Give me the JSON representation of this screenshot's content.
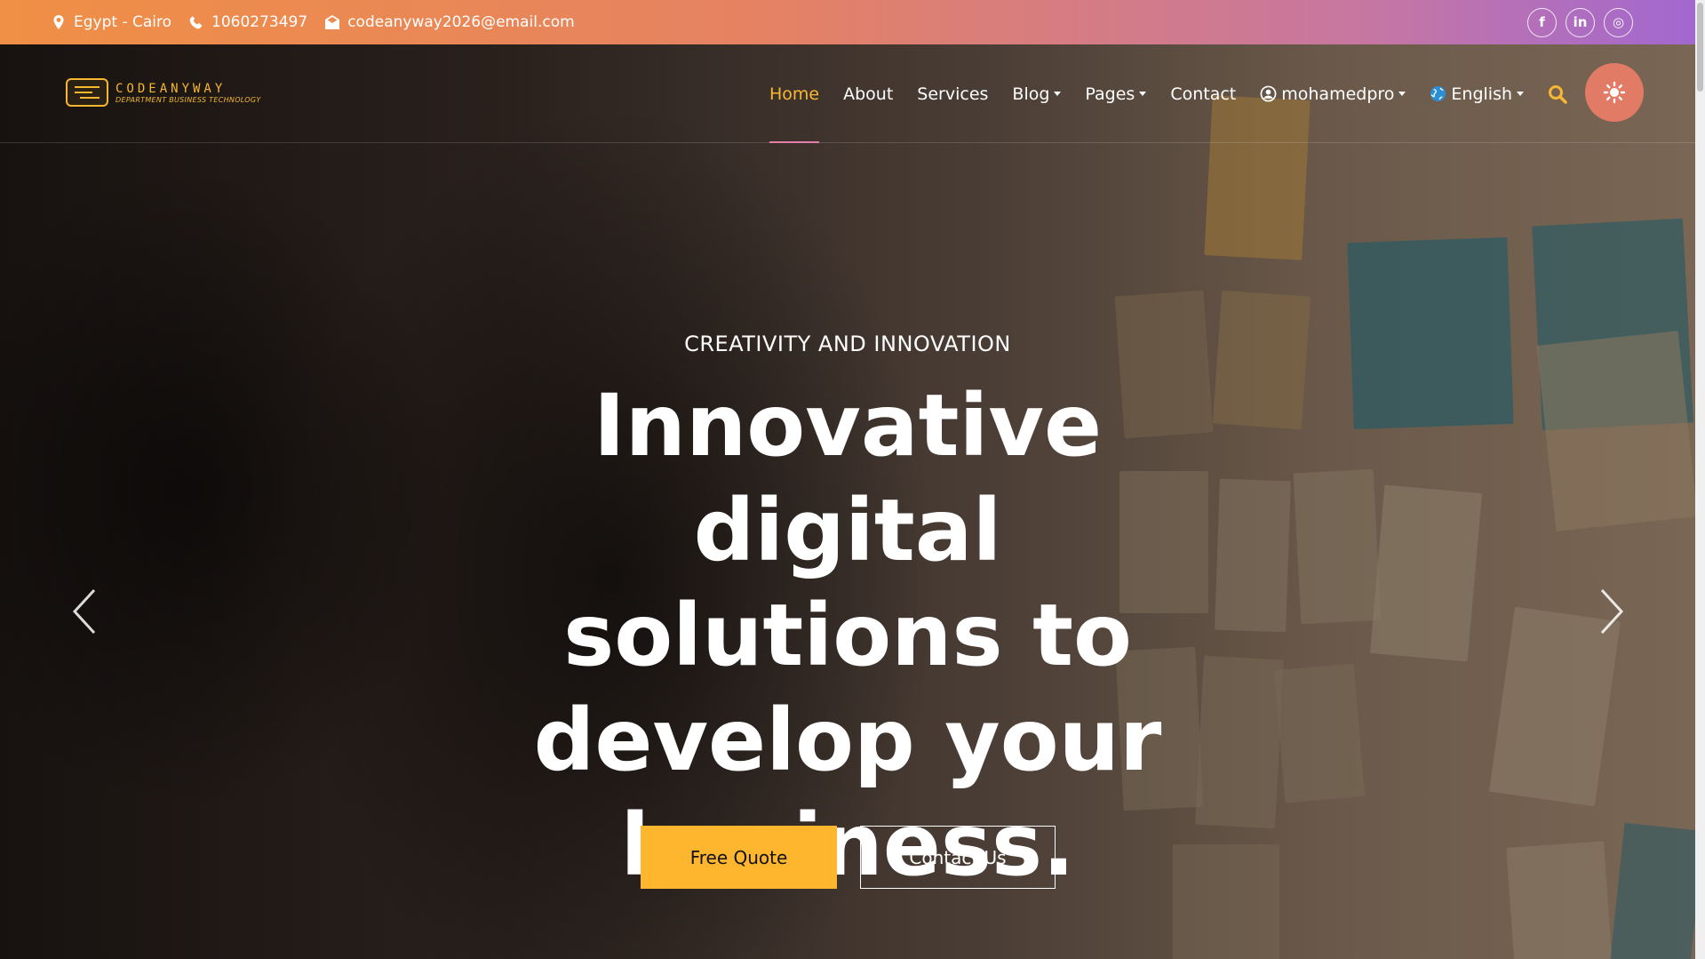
{
  "topbar": {
    "location": "Egypt - Cairo",
    "phone": "1060273497",
    "email": "codeanyway2026@email.com",
    "social": [
      {
        "icon": "facebook-icon",
        "glyph": "f"
      },
      {
        "icon": "linkedin-icon",
        "glyph": "in"
      },
      {
        "icon": "instagram-icon",
        "glyph": "◎"
      }
    ]
  },
  "logo": {
    "name": "CODEANYWAY",
    "tagline": "DEPARTMENT BUSINESS TECHNOLOGY"
  },
  "nav": {
    "items": [
      {
        "label": "Home",
        "active": true
      },
      {
        "label": "About"
      },
      {
        "label": "Services"
      },
      {
        "label": "Blog",
        "dropdown": true
      },
      {
        "label": "Pages",
        "dropdown": true
      },
      {
        "label": "Contact"
      }
    ],
    "user": "mohamedpro",
    "language": "English"
  },
  "hero": {
    "eyebrow": "CREATIVITY AND INNOVATION",
    "headline_lines": [
      "Innovative digital",
      "solutions to",
      "develop your",
      "business."
    ],
    "primary_button": "Free Quote",
    "secondary_button": "Contact Us"
  },
  "colors": {
    "accent": "#fdb62d",
    "active_nav": "#f8b733",
    "theme_button": "#e27b66",
    "topbar_start": "#f08f45",
    "topbar_end": "#a268d0"
  }
}
